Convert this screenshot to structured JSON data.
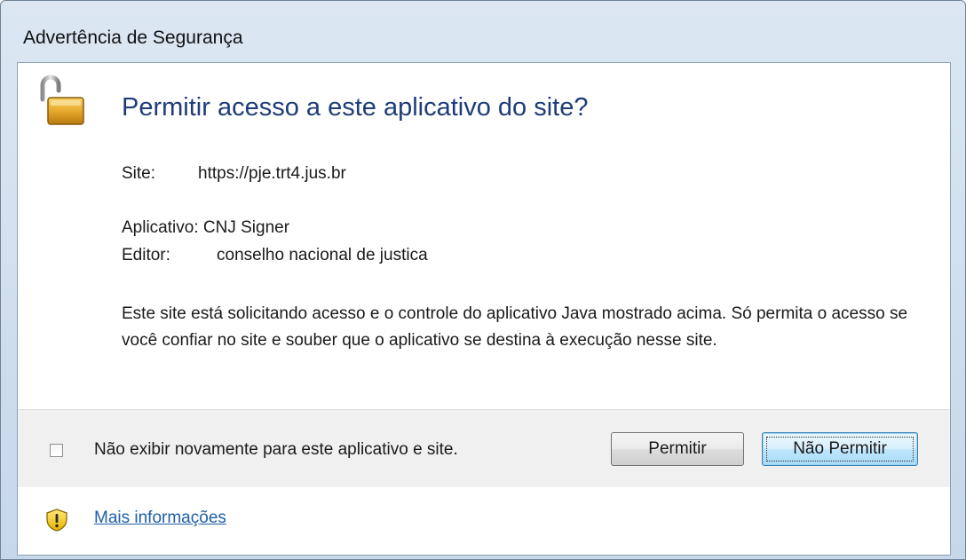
{
  "window": {
    "title": "Advertência de Segurança"
  },
  "dialog": {
    "heading": "Permitir acesso a este aplicativo do site?",
    "site_label": "Site:",
    "site_value": "https://pje.trt4.jus.br",
    "app_label": "Aplicativo:",
    "app_value": "CNJ Signer",
    "publisher_label": "Editor:",
    "publisher_value": "conselho nacional de justica",
    "description": "Este site está solicitando acesso e o controle do aplicativo Java mostrado acima. Só permita o acesso se você confiar no site e souber que o aplicativo se destina à execução nesse site."
  },
  "footer": {
    "checkbox_label": "Não exibir novamente para este aplicativo e site.",
    "checkbox_checked": false,
    "allow_label": "Permitir",
    "deny_label": "Não Permitir"
  },
  "more": {
    "link_label": "Mais informações"
  },
  "icons": {
    "lock": "unlocked-padlock-icon",
    "shield": "warning-shield-icon"
  },
  "colors": {
    "heading": "#1e3d78",
    "link": "#1e5fa8",
    "titlebar": "#c6d7ea",
    "footer_bg": "#f0f0f0"
  }
}
